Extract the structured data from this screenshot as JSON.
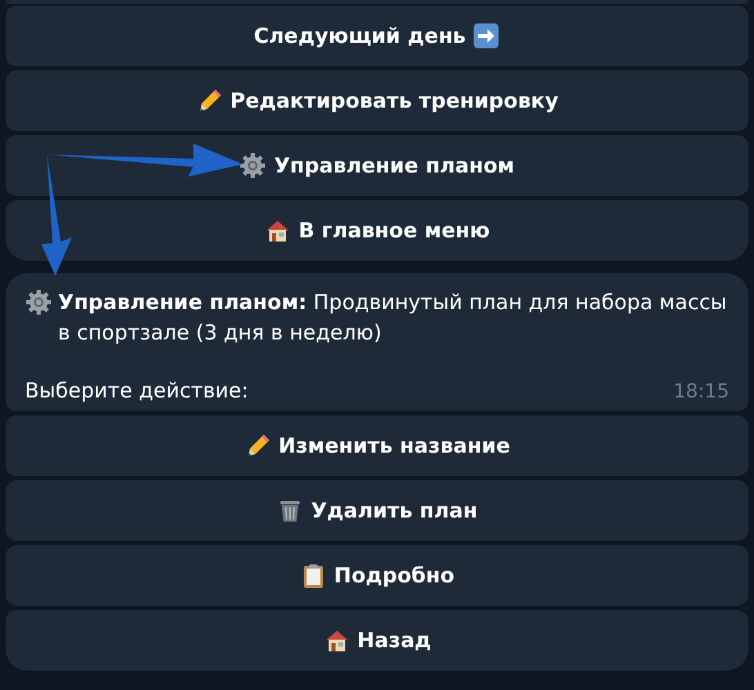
{
  "top_keyboard": {
    "buttons": [
      {
        "label": "Следующий день"
      },
      {
        "label": "Редактировать тренировку"
      },
      {
        "label": "Управление планом"
      },
      {
        "label": "В главное меню"
      }
    ]
  },
  "message": {
    "text": "**Управление планом:** Продвинутый план для набора массы в спортзале (3 дня в неделю)",
    "prompt": "Выберите действие:",
    "time": "18:15"
  },
  "bottom_keyboard": {
    "buttons": [
      {
        "label": "Изменить название"
      },
      {
        "label": "Удалить план"
      },
      {
        "label": "Подробно"
      },
      {
        "label": "Назад"
      }
    ]
  }
}
